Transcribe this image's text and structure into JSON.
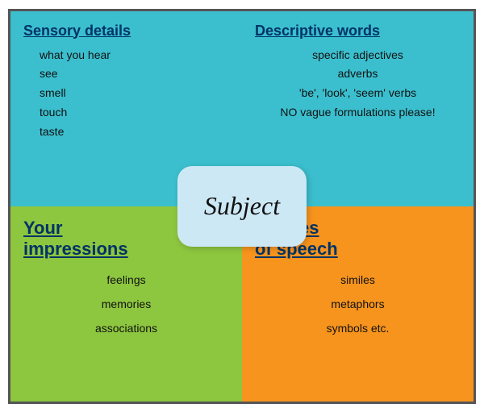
{
  "quadrants": {
    "top_left": {
      "title": "Sensory details",
      "items": [
        "what you hear",
        "see",
        "smell",
        "touch",
        "taste"
      ]
    },
    "top_right": {
      "title": "Descriptive words",
      "items": [
        "specific adjectives",
        "adverbs",
        "'be', 'look', 'seem' verbs",
        "NO  vague formulations please!"
      ]
    },
    "bottom_left": {
      "title": "Your\nimpressions",
      "items": [
        "feelings",
        "memories",
        "associations"
      ]
    },
    "bottom_right": {
      "title": "Figures\nof speech",
      "items": [
        "similes",
        "metaphors",
        "symbols etc."
      ]
    }
  },
  "center": {
    "label": "Subject"
  }
}
